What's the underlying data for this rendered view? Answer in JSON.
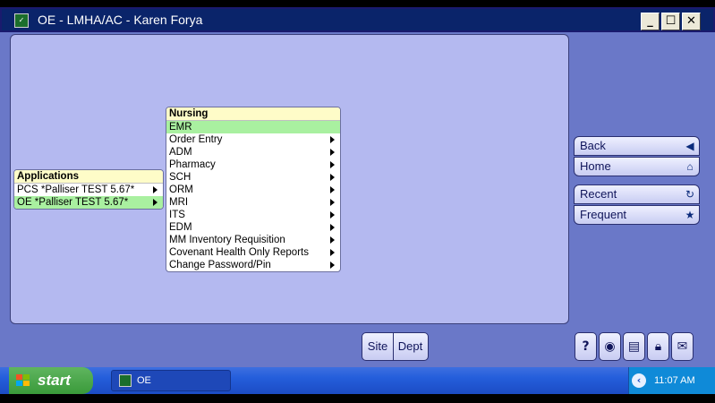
{
  "window": {
    "title": "OE - LMHA/AC  - Karen Forya",
    "controls": {
      "minimize": "_",
      "maximize": "☐",
      "close": "✕"
    },
    "app_icon": "oe-app-icon"
  },
  "applications_menu": {
    "header": "Applications",
    "items": [
      {
        "label": "PCS *Palliser TEST 5.67*",
        "has_submenu": true,
        "selected": false
      },
      {
        "label": "OE *Palliser TEST 5.67*",
        "has_submenu": true,
        "selected": true
      }
    ]
  },
  "nursing_menu": {
    "header": "Nursing",
    "items": [
      {
        "label": "EMR",
        "has_submenu": false,
        "selected": true
      },
      {
        "label": "Order Entry",
        "has_submenu": true,
        "selected": false
      },
      {
        "label": "ADM",
        "has_submenu": true,
        "selected": false
      },
      {
        "label": "Pharmacy",
        "has_submenu": true,
        "selected": false
      },
      {
        "label": "SCH",
        "has_submenu": true,
        "selected": false
      },
      {
        "label": "ORM",
        "has_submenu": true,
        "selected": false
      },
      {
        "label": "MRI",
        "has_submenu": true,
        "selected": false
      },
      {
        "label": "ITS",
        "has_submenu": true,
        "selected": false
      },
      {
        "label": "EDM",
        "has_submenu": true,
        "selected": false
      },
      {
        "label": "MM Inventory Requisition",
        "has_submenu": true,
        "selected": false
      },
      {
        "label": "Covenant Health Only Reports",
        "has_submenu": true,
        "selected": false
      },
      {
        "label": "Change Password/Pin",
        "has_submenu": true,
        "selected": false
      }
    ]
  },
  "nav_buttons": {
    "back": {
      "label": "Back",
      "icon": "back-arrow-icon"
    },
    "home": {
      "label": "Home",
      "icon": "home-icon"
    },
    "recent": {
      "label": "Recent",
      "icon": "recent-icon"
    },
    "frequent": {
      "label": "Frequent",
      "icon": "frequent-icon"
    }
  },
  "bottom_buttons": {
    "site": "Site",
    "dept": "Dept",
    "help": "?"
  },
  "taskbar": {
    "start": "start",
    "task_label": "OE",
    "clock": "11:07 AM"
  },
  "colors": {
    "titlebar": "#0a246a",
    "client_bg": "#6a78c8",
    "workspace_bg": "#b4b9f0",
    "menu_header": "#fefcc8",
    "menu_selected": "#a9f0a0",
    "taskbar": "#245edb",
    "start_button": "#3a9a3a"
  }
}
